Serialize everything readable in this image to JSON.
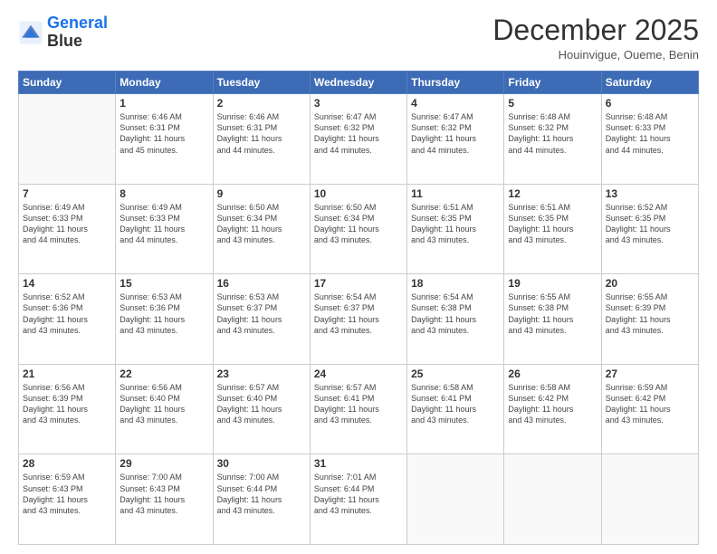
{
  "header": {
    "logo_line1": "General",
    "logo_line2": "Blue",
    "month_title": "December 2025",
    "location": "Houinvigue, Oueme, Benin"
  },
  "days_of_week": [
    "Sunday",
    "Monday",
    "Tuesday",
    "Wednesday",
    "Thursday",
    "Friday",
    "Saturday"
  ],
  "weeks": [
    [
      {
        "day": "",
        "info": ""
      },
      {
        "day": "1",
        "info": "Sunrise: 6:46 AM\nSunset: 6:31 PM\nDaylight: 11 hours\nand 45 minutes."
      },
      {
        "day": "2",
        "info": "Sunrise: 6:46 AM\nSunset: 6:31 PM\nDaylight: 11 hours\nand 44 minutes."
      },
      {
        "day": "3",
        "info": "Sunrise: 6:47 AM\nSunset: 6:32 PM\nDaylight: 11 hours\nand 44 minutes."
      },
      {
        "day": "4",
        "info": "Sunrise: 6:47 AM\nSunset: 6:32 PM\nDaylight: 11 hours\nand 44 minutes."
      },
      {
        "day": "5",
        "info": "Sunrise: 6:48 AM\nSunset: 6:32 PM\nDaylight: 11 hours\nand 44 minutes."
      },
      {
        "day": "6",
        "info": "Sunrise: 6:48 AM\nSunset: 6:33 PM\nDaylight: 11 hours\nand 44 minutes."
      }
    ],
    [
      {
        "day": "7",
        "info": "Sunrise: 6:49 AM\nSunset: 6:33 PM\nDaylight: 11 hours\nand 44 minutes."
      },
      {
        "day": "8",
        "info": "Sunrise: 6:49 AM\nSunset: 6:33 PM\nDaylight: 11 hours\nand 44 minutes."
      },
      {
        "day": "9",
        "info": "Sunrise: 6:50 AM\nSunset: 6:34 PM\nDaylight: 11 hours\nand 43 minutes."
      },
      {
        "day": "10",
        "info": "Sunrise: 6:50 AM\nSunset: 6:34 PM\nDaylight: 11 hours\nand 43 minutes."
      },
      {
        "day": "11",
        "info": "Sunrise: 6:51 AM\nSunset: 6:35 PM\nDaylight: 11 hours\nand 43 minutes."
      },
      {
        "day": "12",
        "info": "Sunrise: 6:51 AM\nSunset: 6:35 PM\nDaylight: 11 hours\nand 43 minutes."
      },
      {
        "day": "13",
        "info": "Sunrise: 6:52 AM\nSunset: 6:35 PM\nDaylight: 11 hours\nand 43 minutes."
      }
    ],
    [
      {
        "day": "14",
        "info": "Sunrise: 6:52 AM\nSunset: 6:36 PM\nDaylight: 11 hours\nand 43 minutes."
      },
      {
        "day": "15",
        "info": "Sunrise: 6:53 AM\nSunset: 6:36 PM\nDaylight: 11 hours\nand 43 minutes."
      },
      {
        "day": "16",
        "info": "Sunrise: 6:53 AM\nSunset: 6:37 PM\nDaylight: 11 hours\nand 43 minutes."
      },
      {
        "day": "17",
        "info": "Sunrise: 6:54 AM\nSunset: 6:37 PM\nDaylight: 11 hours\nand 43 minutes."
      },
      {
        "day": "18",
        "info": "Sunrise: 6:54 AM\nSunset: 6:38 PM\nDaylight: 11 hours\nand 43 minutes."
      },
      {
        "day": "19",
        "info": "Sunrise: 6:55 AM\nSunset: 6:38 PM\nDaylight: 11 hours\nand 43 minutes."
      },
      {
        "day": "20",
        "info": "Sunrise: 6:55 AM\nSunset: 6:39 PM\nDaylight: 11 hours\nand 43 minutes."
      }
    ],
    [
      {
        "day": "21",
        "info": "Sunrise: 6:56 AM\nSunset: 6:39 PM\nDaylight: 11 hours\nand 43 minutes."
      },
      {
        "day": "22",
        "info": "Sunrise: 6:56 AM\nSunset: 6:40 PM\nDaylight: 11 hours\nand 43 minutes."
      },
      {
        "day": "23",
        "info": "Sunrise: 6:57 AM\nSunset: 6:40 PM\nDaylight: 11 hours\nand 43 minutes."
      },
      {
        "day": "24",
        "info": "Sunrise: 6:57 AM\nSunset: 6:41 PM\nDaylight: 11 hours\nand 43 minutes."
      },
      {
        "day": "25",
        "info": "Sunrise: 6:58 AM\nSunset: 6:41 PM\nDaylight: 11 hours\nand 43 minutes."
      },
      {
        "day": "26",
        "info": "Sunrise: 6:58 AM\nSunset: 6:42 PM\nDaylight: 11 hours\nand 43 minutes."
      },
      {
        "day": "27",
        "info": "Sunrise: 6:59 AM\nSunset: 6:42 PM\nDaylight: 11 hours\nand 43 minutes."
      }
    ],
    [
      {
        "day": "28",
        "info": "Sunrise: 6:59 AM\nSunset: 6:43 PM\nDaylight: 11 hours\nand 43 minutes."
      },
      {
        "day": "29",
        "info": "Sunrise: 7:00 AM\nSunset: 6:43 PM\nDaylight: 11 hours\nand 43 minutes."
      },
      {
        "day": "30",
        "info": "Sunrise: 7:00 AM\nSunset: 6:44 PM\nDaylight: 11 hours\nand 43 minutes."
      },
      {
        "day": "31",
        "info": "Sunrise: 7:01 AM\nSunset: 6:44 PM\nDaylight: 11 hours\nand 43 minutes."
      },
      {
        "day": "",
        "info": ""
      },
      {
        "day": "",
        "info": ""
      },
      {
        "day": "",
        "info": ""
      }
    ]
  ]
}
